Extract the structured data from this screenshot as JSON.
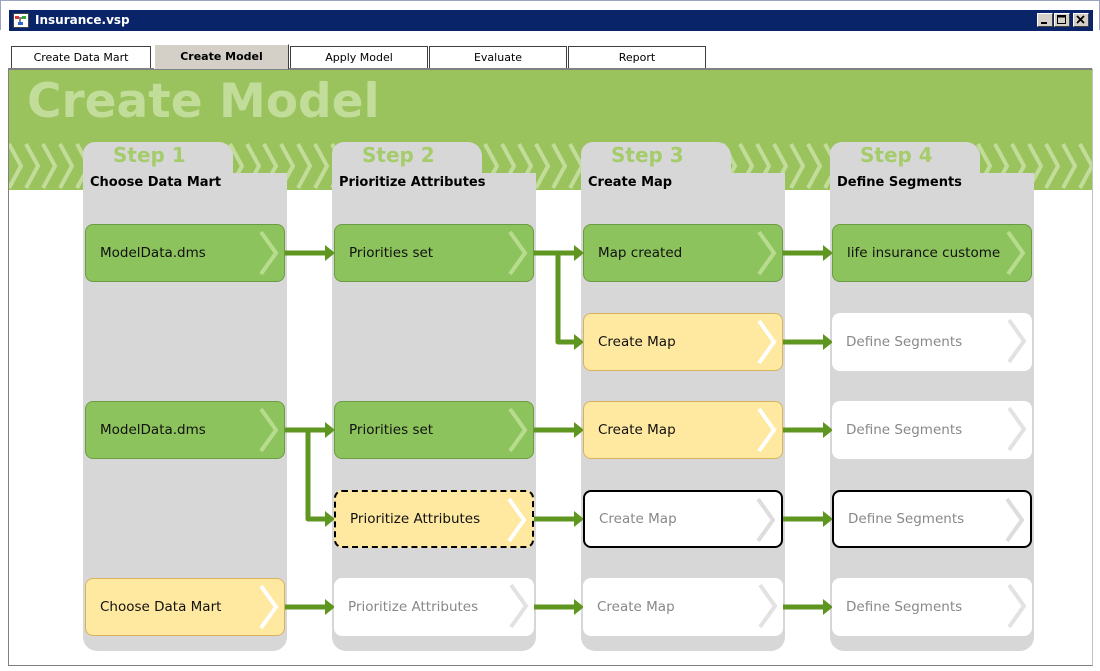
{
  "window": {
    "title": "Insurance.vsp",
    "controls": [
      "minimize",
      "maximize",
      "close"
    ]
  },
  "tabs": [
    {
      "label": "Create Data Mart",
      "active": false
    },
    {
      "label": "Create Model",
      "active": true
    },
    {
      "label": "Apply Model",
      "active": false
    },
    {
      "label": "Evaluate",
      "active": false
    },
    {
      "label": "Report",
      "active": false
    }
  ],
  "banner": {
    "title": "Create Model"
  },
  "steps": [
    {
      "tab_label": "Step 1",
      "heading": "Choose Data Mart"
    },
    {
      "tab_label": "Step 2",
      "heading": "Prioritize Attributes"
    },
    {
      "tab_label": "Step 3",
      "heading": "Create Map"
    },
    {
      "tab_label": "Step 4",
      "heading": "Define Segments"
    }
  ],
  "rows": [
    [
      {
        "label": "ModelData.dms",
        "state": "done"
      },
      {
        "label": "Priorities set",
        "state": "done"
      },
      {
        "label": "Map created",
        "state": "done"
      },
      {
        "label": "life insurance custome",
        "state": "done"
      }
    ],
    [
      null,
      null,
      {
        "label": "Create Map",
        "state": "pending"
      },
      {
        "label": "Define Segments",
        "state": "disabled"
      }
    ],
    [
      {
        "label": "ModelData.dms",
        "state": "done"
      },
      {
        "label": "Priorities set",
        "state": "done"
      },
      {
        "label": "Create Map",
        "state": "pending"
      },
      {
        "label": "Define Segments",
        "state": "disabled"
      }
    ],
    [
      null,
      {
        "label": "Prioritize Attributes",
        "state": "current"
      },
      {
        "label": "Create Map",
        "state": "outlined"
      },
      {
        "label": "Define Segments",
        "state": "outlined"
      }
    ],
    [
      {
        "label": "Choose Data Mart",
        "state": "pending"
      },
      {
        "label": "Prioritize Attributes",
        "state": "disabled"
      },
      {
        "label": "Create Map",
        "state": "disabled"
      },
      {
        "label": "Define Segments",
        "state": "disabled"
      }
    ]
  ],
  "colors": {
    "titlebar": "#0a246a",
    "banner": "#9ac25d",
    "banner_text": "#c2dc9a",
    "column": "#d7d7d7",
    "node_done": "#8dc35c",
    "node_pending": "#ffe9a0",
    "connector": "#5f9620"
  }
}
